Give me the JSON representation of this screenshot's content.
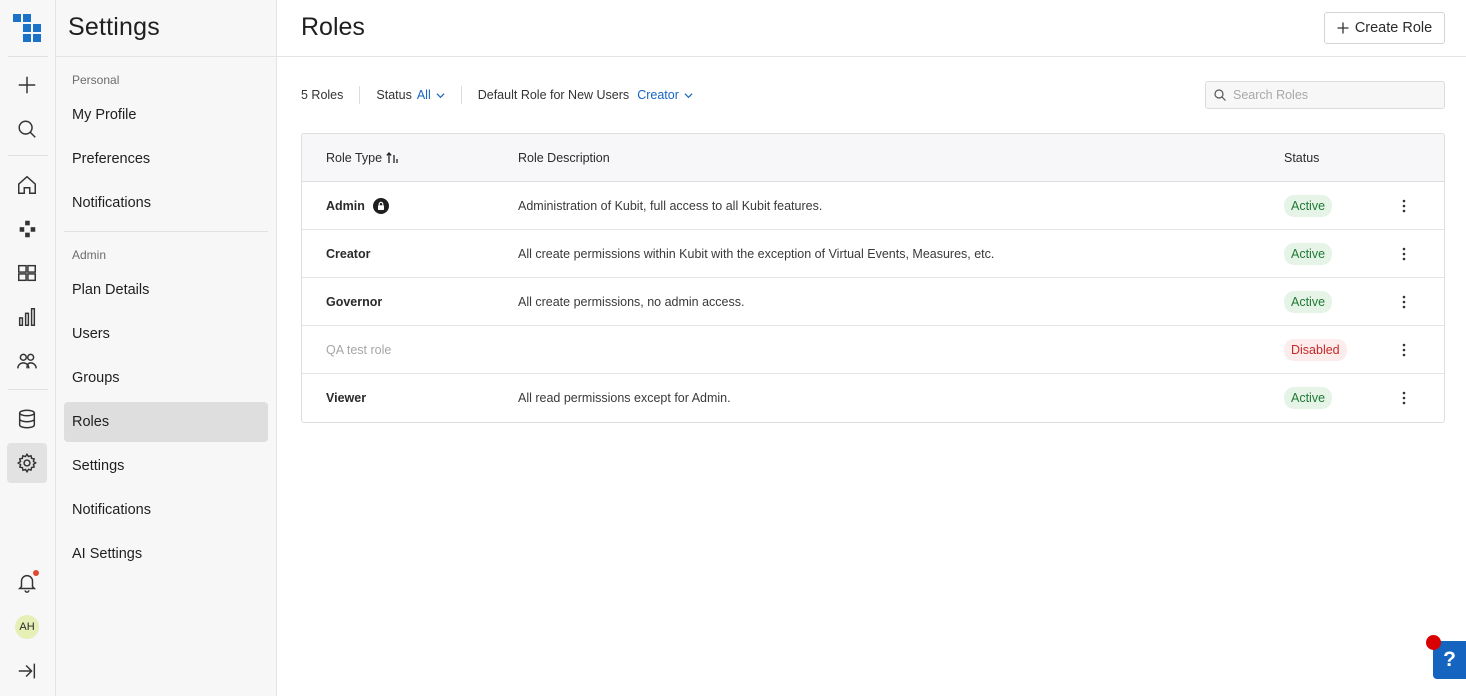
{
  "rail": {
    "avatar_initials": "AH",
    "icons": [
      "kubit-logo-icon",
      "plus-icon",
      "search-icon",
      "home-icon",
      "cluster-icon",
      "dashboard-icon",
      "bar-chart-icon",
      "people-icon",
      "database-icon",
      "gear-icon",
      "bell-icon",
      "collapse-icon"
    ]
  },
  "sidebar": {
    "title": "Settings",
    "sections": [
      {
        "label": "Personal",
        "items": [
          "My Profile",
          "Preferences",
          "Notifications"
        ]
      },
      {
        "label": "Admin",
        "items": [
          "Plan Details",
          "Users",
          "Groups",
          "Roles",
          "Settings",
          "Notifications",
          "AI Settings"
        ]
      }
    ],
    "active_item": "Roles"
  },
  "header": {
    "title": "Roles",
    "create_button": "Create Role"
  },
  "filters": {
    "count": "5 Roles",
    "status_label": "Status",
    "status_value": "All",
    "default_role_label": "Default Role for New Users",
    "default_role_value": "Creator",
    "search_placeholder": "Search Roles"
  },
  "table": {
    "columns": [
      "Role Type",
      "Role Description",
      "Status"
    ],
    "rows": [
      {
        "name": "Admin",
        "description": "Administration of Kubit, full access to all Kubit features.",
        "status": "Active",
        "locked": true
      },
      {
        "name": "Creator",
        "description": "All create permissions within Kubit with the exception of Virtual Events, Measures, etc.",
        "status": "Active",
        "locked": false
      },
      {
        "name": "Governor",
        "description": "All create permissions, no admin access.",
        "status": "Active",
        "locked": false
      },
      {
        "name": "QA test role",
        "description": "",
        "status": "Disabled",
        "locked": false
      },
      {
        "name": "Viewer",
        "description": "All read permissions except for Admin.",
        "status": "Active",
        "locked": false
      }
    ]
  },
  "help": {
    "label": "?"
  },
  "colors": {
    "accent": "#1565c0",
    "logo": "#1a73c9",
    "active_badge_bg": "#e6f4e7",
    "active_badge_text": "#1f7a33",
    "disabled_badge_bg": "#fdecec",
    "disabled_badge_text": "#c62828"
  }
}
